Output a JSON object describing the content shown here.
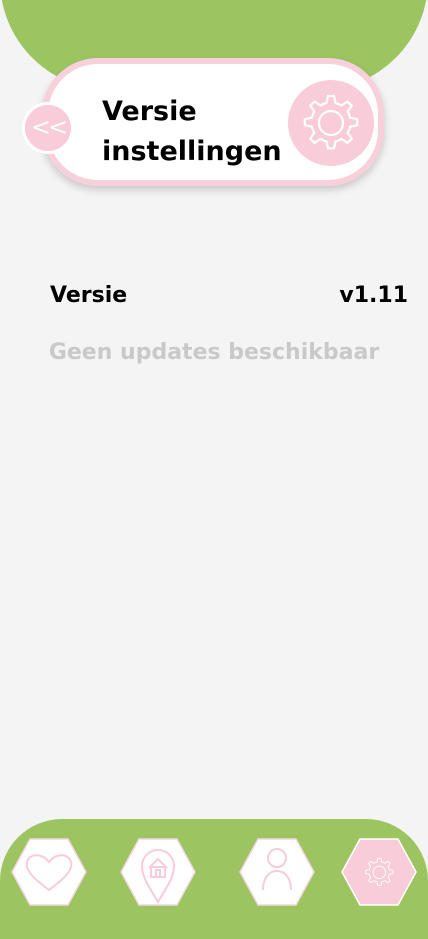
{
  "header": {
    "title": "Versie\ninstellingen",
    "back_label": "<<"
  },
  "version": {
    "label": "Versie",
    "value": "v1.11",
    "update_status": "Geen updates beschikbaar"
  },
  "nav": {
    "items": [
      {
        "name": "favorites",
        "icon": "heart-icon",
        "active": false
      },
      {
        "name": "home",
        "icon": "home-location-icon",
        "active": false
      },
      {
        "name": "profile",
        "icon": "person-icon",
        "active": false
      },
      {
        "name": "settings",
        "icon": "gear-icon",
        "active": true
      }
    ]
  },
  "colors": {
    "accent_green": "#9cc562",
    "accent_pink": "#f8ccd8",
    "background": "#f4f4f4",
    "muted_text": "#c9c9c9"
  }
}
